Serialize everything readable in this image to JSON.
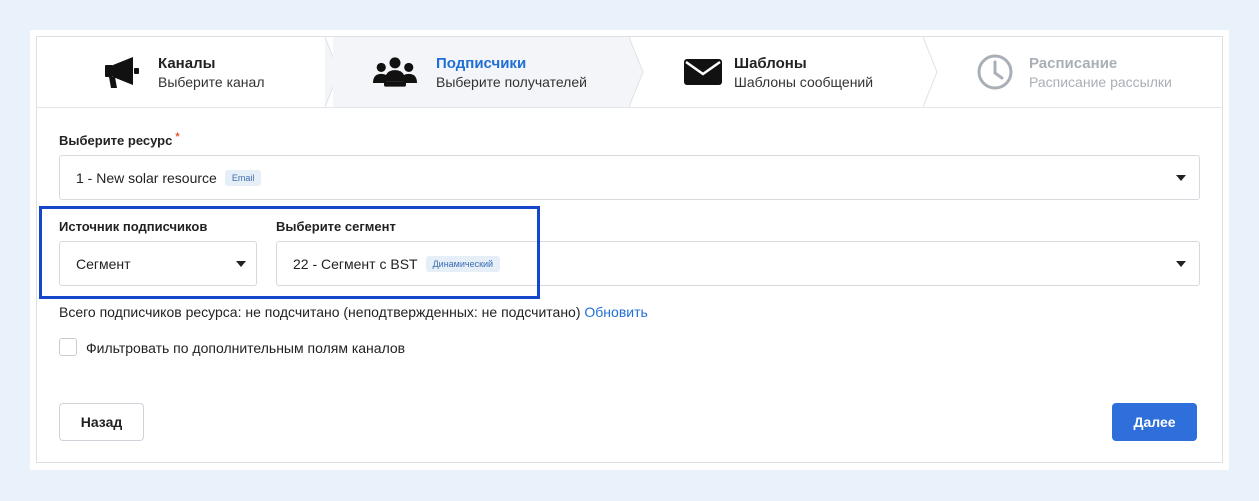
{
  "steps": [
    {
      "title": "Каналы",
      "subtitle": "Выберите канал",
      "icon": "megaphone-icon",
      "state": "done"
    },
    {
      "title": "Подписчики",
      "subtitle": "Выберите получателей",
      "icon": "users-icon",
      "state": "active"
    },
    {
      "title": "Шаблоны",
      "subtitle": "Шаблоны сообщений",
      "icon": "envelope-icon",
      "state": "done"
    },
    {
      "title": "Расписание",
      "subtitle": "Расписание рассылки",
      "icon": "clock-icon",
      "state": "disabled"
    }
  ],
  "resource": {
    "label": "Выберите ресурс",
    "required_mark": "*",
    "value": "1 - New solar resource",
    "badge": "Email"
  },
  "source": {
    "label": "Источник подписчиков",
    "value": "Сегмент"
  },
  "segment": {
    "label": "Выберите сегмент",
    "value": "22 - Сегмент с BST",
    "badge": "Динамический"
  },
  "info": {
    "text": "Всего подписчиков ресурса: не подсчитано (неподтвержденных: не подсчитано)",
    "link": "Обновить"
  },
  "filter": {
    "label": "Фильтровать по дополнительным полям каналов",
    "checked": false
  },
  "buttons": {
    "back": "Назад",
    "next": "Далее"
  },
  "colors": {
    "accent": "#1f6fd6",
    "primary_button": "#2e6fdc",
    "highlight_border": "#1646c9",
    "required": "#e2572b"
  }
}
